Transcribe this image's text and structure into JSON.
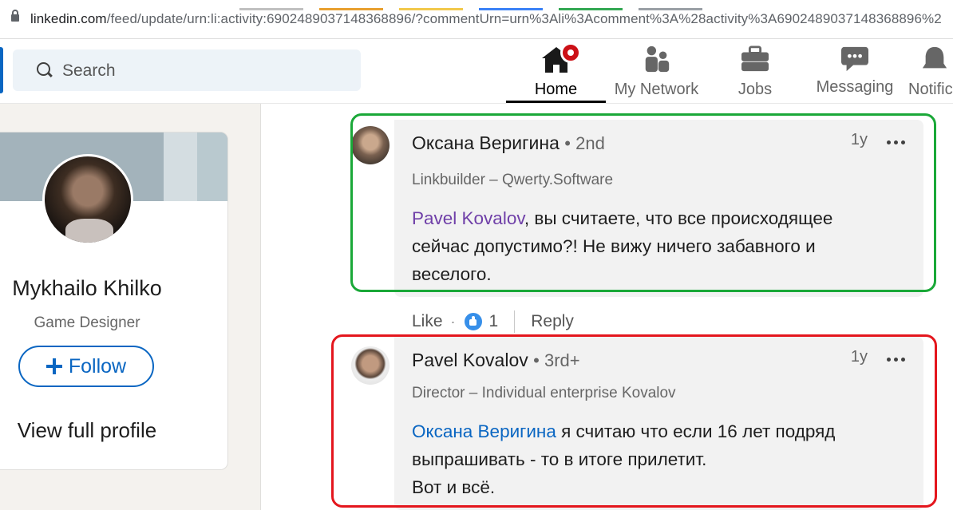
{
  "browser": {
    "url_host": "linkedin.com",
    "url_path": "/feed/update/urn:li:activity:6902489037148368896/?commentUrn=urn%3Ali%3Acomment%3A%28activity%3A6902489037148368896%2"
  },
  "nav": {
    "search_placeholder": "Search",
    "items": [
      {
        "label": "Home",
        "icon": "home-icon"
      },
      {
        "label": "My Network",
        "icon": "network-icon"
      },
      {
        "label": "Jobs",
        "icon": "briefcase-icon"
      },
      {
        "label": "Messaging",
        "icon": "messaging-icon"
      },
      {
        "label": "Notific",
        "icon": "bell-icon"
      }
    ]
  },
  "profile": {
    "name": "Mykhailo Khilko",
    "role": "Game Designer",
    "follow_label": "Follow",
    "view_profile_label": "View full profile"
  },
  "comments": [
    {
      "author": "Оксана Веригина",
      "degree": "• 2nd",
      "headline": "Linkbuilder – Qwerty.Software",
      "time": "1y",
      "mention": "Pavel Kovalov",
      "text": ", вы считаете, что все происходящее сейчас допустимо?! Не вижу ничего забавного и веселого.",
      "actions": {
        "like": "Like",
        "separator": "·",
        "reaction_count": "1",
        "reply": "Reply"
      }
    },
    {
      "author": "Pavel Kovalov",
      "degree": "• 3rd+",
      "headline": "Director – Individual enterprise Kovalov",
      "time": "1y",
      "mention": "Оксана Веригина",
      "text_line1": " я считаю что если 16 лет подряд выпрашивать - то в итоге прилетит.",
      "text_line2": "Вот и всё."
    }
  ],
  "colors": {
    "linkedin_blue": "#0a66c2",
    "highlight_green": "#1aa838",
    "highlight_red": "#e4161d",
    "mention_purple": "#6f3fa8"
  }
}
